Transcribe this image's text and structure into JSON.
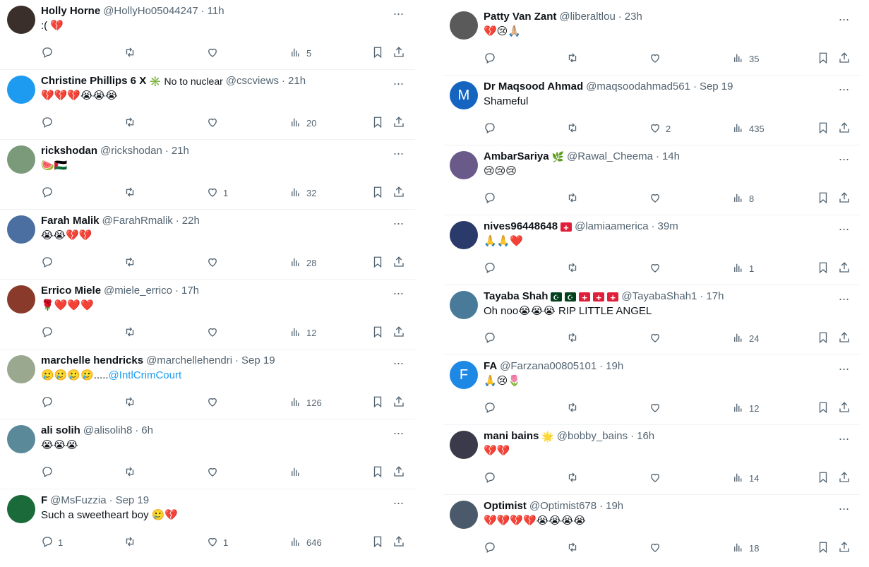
{
  "left": [
    {
      "avatar_color": "#3a2f2a",
      "avatar_icon": "photo-avatar",
      "name": "Holly Horne",
      "badge": "",
      "flags": [],
      "handle": "@HollyHo05044247",
      "time": "11h",
      "text": ":( 💔",
      "link": "",
      "replies": "",
      "likes": "",
      "views": "5"
    },
    {
      "avatar_color": "#1d9bf0",
      "avatar_icon": "bird-avatar",
      "name": "Christine Phillips 6 X",
      "badge": "✳️ No to nuclear",
      "flags": [],
      "handle": "@cscviews",
      "time": "21h",
      "text": "💔💔💔😭😭😭",
      "link": "",
      "replies": "",
      "likes": "",
      "views": "20"
    },
    {
      "avatar_color": "#7a9a7a",
      "avatar_icon": "photo-avatar",
      "name": "rickshodan",
      "badge": "",
      "flags": [],
      "handle": "@rickshodan",
      "time": "21h",
      "text": "🍉🇵🇸",
      "link": "",
      "replies": "",
      "likes": "1",
      "views": "32"
    },
    {
      "avatar_color": "#4a6fa0",
      "avatar_icon": "photo-avatar",
      "name": "Farah Malik",
      "badge": "",
      "flags": [],
      "handle": "@FarahRmalik",
      "time": "22h",
      "text": "😭😭💔💔",
      "link": "",
      "replies": "",
      "likes": "",
      "views": "28"
    },
    {
      "avatar_color": "#8a3a2a",
      "avatar_icon": "photo-avatar",
      "name": "Errico Miele",
      "badge": "",
      "flags": [],
      "handle": "@miele_errico",
      "time": "17h",
      "text": "🌹❤️❤️❤️",
      "link": "",
      "replies": "",
      "likes": "",
      "views": "12"
    },
    {
      "avatar_color": "#9aa890",
      "avatar_icon": "photo-avatar",
      "name": "marchelle hendricks",
      "badge": "",
      "flags": [],
      "handle": "@marchellehendri",
      "time": "Sep 19",
      "text": "🥲🥲🥲🥲.....",
      "link": "@IntlCrimCourt",
      "replies": "",
      "likes": "",
      "views": "126"
    },
    {
      "avatar_color": "#5a8a9a",
      "avatar_icon": "photo-avatar",
      "name": "ali solih",
      "badge": "",
      "flags": [],
      "handle": "@alisolih8",
      "time": "6h",
      "text": "😭😭😭",
      "link": "",
      "replies": "",
      "likes": "",
      "views": ""
    },
    {
      "avatar_color": "#1a6a3a",
      "avatar_icon": "photo-avatar",
      "name": "F",
      "badge": "",
      "flags": [],
      "handle": "@MsFuzzia",
      "time": "Sep 19",
      "text": "Such a sweetheart boy 🥲💔",
      "link": "",
      "replies": "1",
      "likes": "1",
      "views": "646"
    }
  ],
  "right": [
    {
      "avatar_color": "#5a5a5a",
      "avatar_icon": "photo-avatar",
      "name": "Patty Van Zant",
      "badge": "",
      "flags": [],
      "handle": "@liberaltlou",
      "time": "23h",
      "text": "💔😢🙏🏼",
      "link": "",
      "replies": "",
      "likes": "",
      "views": "35"
    },
    {
      "avatar_color": "#1565c0",
      "avatar_icon": "letter-avatar",
      "avatar_letter": "M",
      "name": "Dr Maqsood Ahmad",
      "badge": "",
      "flags": [],
      "handle": "@maqsoodahmad561",
      "time": "Sep 19",
      "text": "Shameful",
      "link": "",
      "replies": "",
      "likes": "2",
      "views": "435"
    },
    {
      "avatar_color": "#6a5a8a",
      "avatar_icon": "photo-avatar",
      "name": "AmbarSariya",
      "badge": "🌿",
      "flags": [],
      "handle": "@Rawal_Cheema",
      "time": "14h",
      "text": "😢😢😢",
      "link": "",
      "replies": "",
      "likes": "",
      "views": "8"
    },
    {
      "avatar_color": "#2a3a6a",
      "avatar_icon": "photo-avatar",
      "name": "nives96448648",
      "badge": "",
      "flags": [
        "ch"
      ],
      "handle": "@lamiaamerica",
      "time": "39m",
      "text": "🙏🙏❤️",
      "link": "",
      "replies": "",
      "likes": "",
      "views": "1"
    },
    {
      "avatar_color": "#4a7a9a",
      "avatar_icon": "photo-avatar",
      "name": "Tayaba Shah",
      "badge": "",
      "flags": [
        "pk",
        "pk",
        "ch",
        "ch",
        "ch"
      ],
      "handle": "@TayabaShah1",
      "time": "17h",
      "text": "Oh noo😭😭😭 RIP LITTLE ANGEL",
      "link": "",
      "replies": "",
      "likes": "",
      "views": "24"
    },
    {
      "avatar_color": "#1e88e5",
      "avatar_icon": "letter-avatar",
      "avatar_letter": "F",
      "name": "FA",
      "badge": "",
      "flags": [],
      "handle": "@Farzana00805101",
      "time": "19h",
      "text": "🙏😢🌷",
      "link": "",
      "replies": "",
      "likes": "",
      "views": "12"
    },
    {
      "avatar_color": "#3a3a4a",
      "avatar_icon": "photo-avatar",
      "name": "mani bains",
      "badge": "🌟",
      "flags": [],
      "handle": "@bobby_bains",
      "time": "16h",
      "text": "💔💔",
      "link": "",
      "replies": "",
      "likes": "",
      "views": "14"
    },
    {
      "avatar_color": "#4a5a6a",
      "avatar_icon": "photo-avatar",
      "name": "Optimist",
      "badge": "",
      "flags": [],
      "handle": "@Optimist678",
      "time": "19h",
      "text": "💔💔💔💔😭😭😭😭",
      "link": "",
      "replies": "",
      "likes": "",
      "views": "18"
    }
  ]
}
